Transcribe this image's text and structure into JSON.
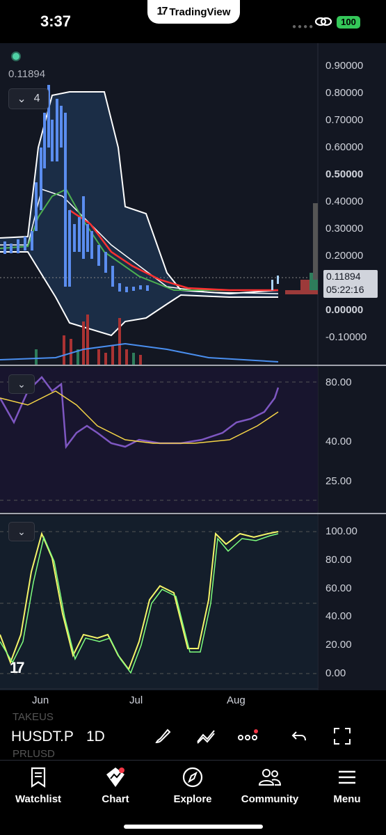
{
  "status": {
    "time": "3:37",
    "tv_label": "TradingView",
    "battery": "100"
  },
  "legend": {
    "price": "0.11894",
    "indicator_count": "4"
  },
  "price_axis": [
    "0.90000",
    "0.80000",
    "0.70000",
    "0.60000",
    "0.50000",
    "0.40000",
    "0.30000",
    "0.20000",
    "0.00000",
    "-0.10000"
  ],
  "price_tag": {
    "price": "0.11894",
    "countdown": "05:22:16"
  },
  "rsi_axis": [
    "80.00",
    "40.00",
    "25.00"
  ],
  "stoch_axis": [
    "100.00",
    "80.00",
    "60.00",
    "40.00",
    "20.00",
    "0.00"
  ],
  "date_axis": [
    "Jun",
    "Jul",
    "Aug"
  ],
  "toolbar": {
    "symbol": "HUSDT.P",
    "symbol_above": "TAKEUS",
    "symbol_below": "PRLUSD",
    "interval": "1D"
  },
  "tabs": [
    {
      "label": "Watchlist",
      "icon": "bookmark-icon"
    },
    {
      "label": "Chart",
      "icon": "chart-icon"
    },
    {
      "label": "Explore",
      "icon": "compass-icon"
    },
    {
      "label": "Community",
      "icon": "people-icon"
    },
    {
      "label": "Menu",
      "icon": "hamburger-icon"
    }
  ],
  "colors": {
    "background": "#131722",
    "rsi": "#7e57c2",
    "rsi_ma": "#f5d547",
    "stoch_k": "#f5f569",
    "stoch_d": "#7fff7f",
    "bb": "#ffffff",
    "ema_red": "#ff3030",
    "ema_green": "#4caf50"
  }
}
